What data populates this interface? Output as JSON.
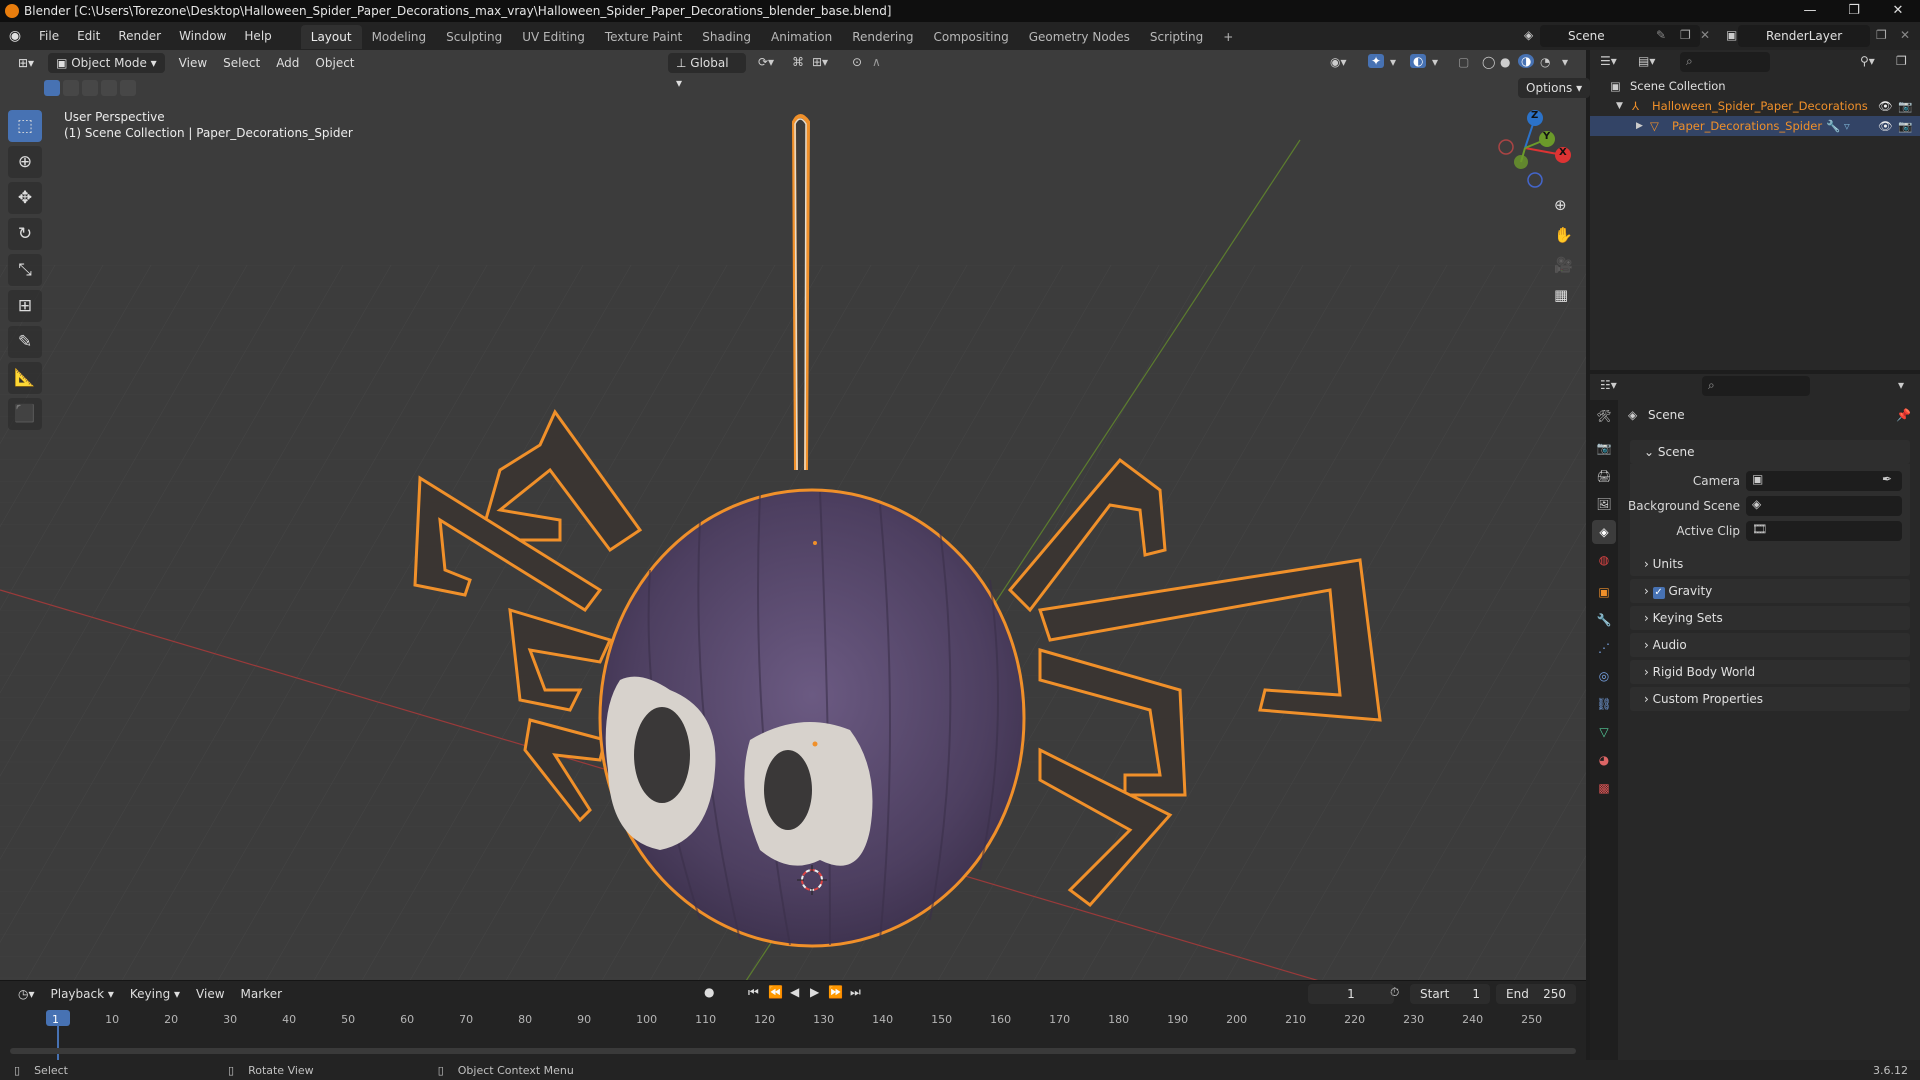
{
  "window": {
    "title": "Blender [C:\\Users\\Torezone\\Desktop\\Halloween_Spider_Paper_Decorations_max_vray\\Halloween_Spider_Paper_Decorations_blender_base.blend]",
    "minimize": "—",
    "maximize": "❐",
    "close": "✕"
  },
  "menus": [
    "File",
    "Edit",
    "Render",
    "Window",
    "Help"
  ],
  "workspaces": [
    "Layout",
    "Modeling",
    "Sculpting",
    "UV Editing",
    "Texture Paint",
    "Shading",
    "Animation",
    "Rendering",
    "Compositing",
    "Geometry Nodes",
    "Scripting"
  ],
  "workspace_add": "+",
  "scene_name": "Scene",
  "render_layer": "RenderLayer",
  "viewport": {
    "mode": "Object Mode",
    "menus": [
      "View",
      "Select",
      "Add",
      "Object"
    ],
    "orientation": "Global",
    "options": "Options",
    "perspective": "User Perspective",
    "collection_info": "(1) Scene Collection | Paper_Decorations_Spider",
    "gizmo_labels": {
      "x": "X",
      "y": "Y",
      "z": "Z"
    }
  },
  "outliner": {
    "root": "Scene Collection",
    "items": [
      {
        "label": "Halloween_Spider_Paper_Decorations"
      },
      {
        "label": "Paper_Decorations_Spider"
      }
    ]
  },
  "properties": {
    "header": "Scene",
    "panel_title": "Scene",
    "fields": [
      {
        "label": "Camera"
      },
      {
        "label": "Background Scene"
      },
      {
        "label": "Active Clip"
      }
    ],
    "sections": [
      "Units",
      "Gravity",
      "Keying Sets",
      "Audio",
      "Rigid Body World",
      "Custom Properties"
    ]
  },
  "timeline": {
    "menus": [
      "Playback",
      "Keying",
      "View",
      "Marker"
    ],
    "current_frame": "1",
    "start_label": "Start",
    "start": "1",
    "end_label": "End",
    "end": "250",
    "ticks": [
      "1",
      "10",
      "20",
      "30",
      "40",
      "50",
      "60",
      "70",
      "80",
      "90",
      "100",
      "110",
      "120",
      "130",
      "140",
      "150",
      "160",
      "170",
      "180",
      "190",
      "200",
      "210",
      "220",
      "230",
      "240",
      "250"
    ]
  },
  "statusbar": {
    "select": "Select",
    "rotate": "Rotate View",
    "context": "Object Context Menu",
    "version": "3.6.12"
  },
  "colors": {
    "selection_orange": "#f0902a",
    "active_blue": "#4772b3",
    "spider_purple": "#5a4a6e"
  }
}
